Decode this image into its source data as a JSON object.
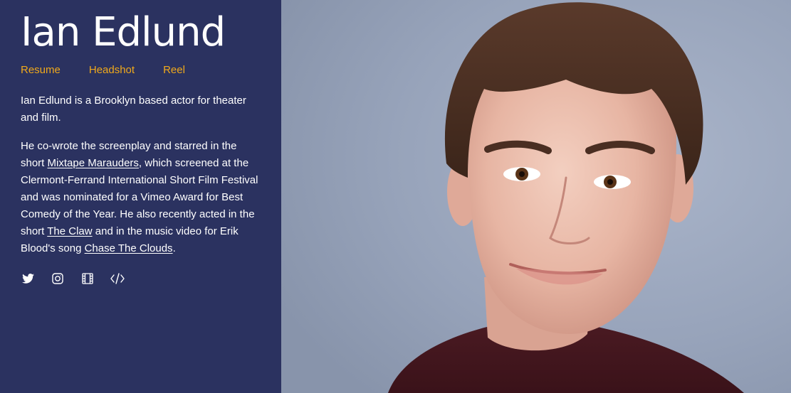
{
  "profile": {
    "name": "Ian Edlund"
  },
  "nav": {
    "items": [
      {
        "label": "Resume"
      },
      {
        "label": "Headshot"
      },
      {
        "label": "Reel"
      }
    ]
  },
  "bio": {
    "paragraph1": "Ian Edlund is a Brooklyn based actor for theater and film.",
    "p2_part1": "He co-wrote the screenplay and starred in the short ",
    "p2_link1": "Mixtape Marauders",
    "p2_part2": ", which screened at the Clermont-Ferrand International Short Film Festival and was nominated for a Vimeo Award for Best Comedy of the Year. He also recently acted in the short ",
    "p2_link2": "The Claw",
    "p2_part3": " and in the music video for Erik Blood's song ",
    "p2_link3": "Chase The Clouds",
    "p2_part4": "."
  },
  "social": {
    "icons": [
      "twitter-icon",
      "instagram-icon",
      "film-icon",
      "code-icon"
    ]
  },
  "colors": {
    "sidebar_bg": "#2b3260",
    "nav_link": "#f0a91b",
    "text": "#ffffff",
    "photo_bg": "#98a4bb"
  }
}
